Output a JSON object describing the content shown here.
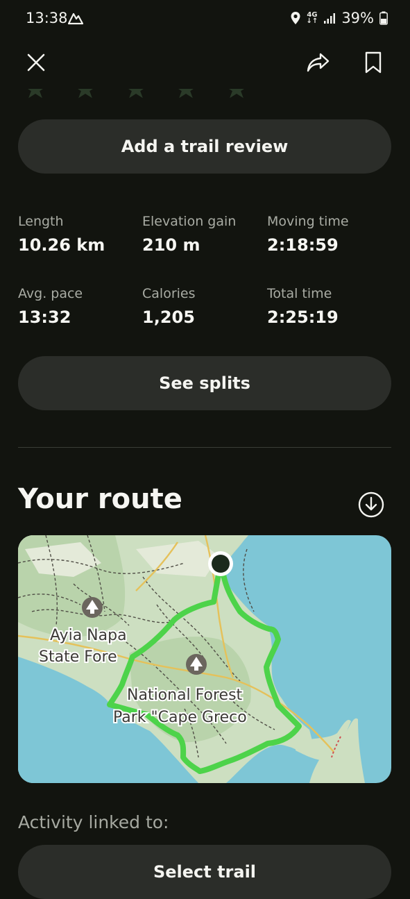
{
  "status_bar": {
    "time": "13:38",
    "app_icon": "alltrails-mountain-icon",
    "network_top": "4G",
    "network_bottom": "↓↑",
    "battery": "39%",
    "icons": [
      "location-icon",
      "signal-icon",
      "battery-icon"
    ]
  },
  "top_bar": {
    "close_icon": "close-icon",
    "share_icon": "share-icon",
    "bookmark_icon": "bookmark-icon"
  },
  "review_button": {
    "label": "Add a trail review"
  },
  "stats": [
    {
      "label": "Length",
      "value": "10.26 km"
    },
    {
      "label": "Elevation gain",
      "value": "210 m"
    },
    {
      "label": "Moving time",
      "value": "2:18:59"
    },
    {
      "label": "Avg. pace",
      "value": "13:32"
    },
    {
      "label": "Calories",
      "value": "1,205"
    },
    {
      "label": "Total time",
      "value": "2:25:19"
    }
  ],
  "splits_button": {
    "label": "See splits"
  },
  "route": {
    "title": "Your route",
    "download_icon": "download-icon",
    "map_labels": {
      "forest1_line1": "Ayia Napa",
      "forest1_line2": "State Fore",
      "forest2_line1": "National Forest",
      "forest2_line2": "Park \"Cape Greco"
    },
    "colors": {
      "sea": "#7ec6d6",
      "land": "#c7dcbc",
      "route": "#4dd34a"
    }
  },
  "linked": {
    "label": "Activity linked to:",
    "button_label": "Select trail"
  }
}
